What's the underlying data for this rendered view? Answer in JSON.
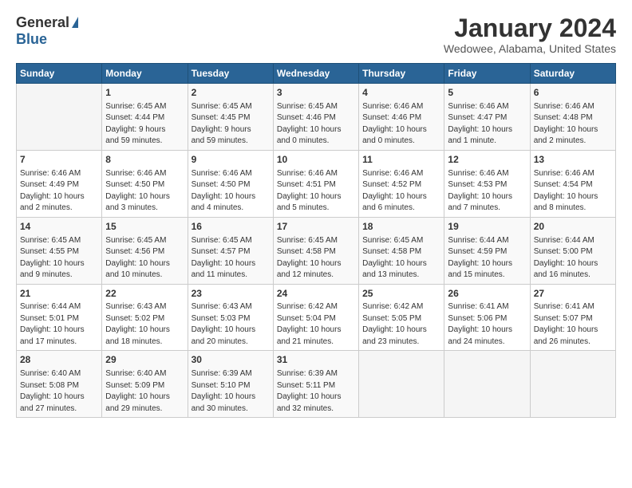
{
  "logo": {
    "general": "General",
    "blue": "Blue"
  },
  "title": "January 2024",
  "subtitle": "Wedowee, Alabama, United States",
  "weekdays": [
    "Sunday",
    "Monday",
    "Tuesday",
    "Wednesday",
    "Thursday",
    "Friday",
    "Saturday"
  ],
  "weeks": [
    [
      {
        "day": "",
        "info": ""
      },
      {
        "day": "1",
        "info": "Sunrise: 6:45 AM\nSunset: 4:44 PM\nDaylight: 9 hours\nand 59 minutes."
      },
      {
        "day": "2",
        "info": "Sunrise: 6:45 AM\nSunset: 4:45 PM\nDaylight: 9 hours\nand 59 minutes."
      },
      {
        "day": "3",
        "info": "Sunrise: 6:45 AM\nSunset: 4:46 PM\nDaylight: 10 hours\nand 0 minutes."
      },
      {
        "day": "4",
        "info": "Sunrise: 6:46 AM\nSunset: 4:46 PM\nDaylight: 10 hours\nand 0 minutes."
      },
      {
        "day": "5",
        "info": "Sunrise: 6:46 AM\nSunset: 4:47 PM\nDaylight: 10 hours\nand 1 minute."
      },
      {
        "day": "6",
        "info": "Sunrise: 6:46 AM\nSunset: 4:48 PM\nDaylight: 10 hours\nand 2 minutes."
      }
    ],
    [
      {
        "day": "7",
        "info": "Sunrise: 6:46 AM\nSunset: 4:49 PM\nDaylight: 10 hours\nand 2 minutes."
      },
      {
        "day": "8",
        "info": "Sunrise: 6:46 AM\nSunset: 4:50 PM\nDaylight: 10 hours\nand 3 minutes."
      },
      {
        "day": "9",
        "info": "Sunrise: 6:46 AM\nSunset: 4:50 PM\nDaylight: 10 hours\nand 4 minutes."
      },
      {
        "day": "10",
        "info": "Sunrise: 6:46 AM\nSunset: 4:51 PM\nDaylight: 10 hours\nand 5 minutes."
      },
      {
        "day": "11",
        "info": "Sunrise: 6:46 AM\nSunset: 4:52 PM\nDaylight: 10 hours\nand 6 minutes."
      },
      {
        "day": "12",
        "info": "Sunrise: 6:46 AM\nSunset: 4:53 PM\nDaylight: 10 hours\nand 7 minutes."
      },
      {
        "day": "13",
        "info": "Sunrise: 6:46 AM\nSunset: 4:54 PM\nDaylight: 10 hours\nand 8 minutes."
      }
    ],
    [
      {
        "day": "14",
        "info": "Sunrise: 6:45 AM\nSunset: 4:55 PM\nDaylight: 10 hours\nand 9 minutes."
      },
      {
        "day": "15",
        "info": "Sunrise: 6:45 AM\nSunset: 4:56 PM\nDaylight: 10 hours\nand 10 minutes."
      },
      {
        "day": "16",
        "info": "Sunrise: 6:45 AM\nSunset: 4:57 PM\nDaylight: 10 hours\nand 11 minutes."
      },
      {
        "day": "17",
        "info": "Sunrise: 6:45 AM\nSunset: 4:58 PM\nDaylight: 10 hours\nand 12 minutes."
      },
      {
        "day": "18",
        "info": "Sunrise: 6:45 AM\nSunset: 4:58 PM\nDaylight: 10 hours\nand 13 minutes."
      },
      {
        "day": "19",
        "info": "Sunrise: 6:44 AM\nSunset: 4:59 PM\nDaylight: 10 hours\nand 15 minutes."
      },
      {
        "day": "20",
        "info": "Sunrise: 6:44 AM\nSunset: 5:00 PM\nDaylight: 10 hours\nand 16 minutes."
      }
    ],
    [
      {
        "day": "21",
        "info": "Sunrise: 6:44 AM\nSunset: 5:01 PM\nDaylight: 10 hours\nand 17 minutes."
      },
      {
        "day": "22",
        "info": "Sunrise: 6:43 AM\nSunset: 5:02 PM\nDaylight: 10 hours\nand 18 minutes."
      },
      {
        "day": "23",
        "info": "Sunrise: 6:43 AM\nSunset: 5:03 PM\nDaylight: 10 hours\nand 20 minutes."
      },
      {
        "day": "24",
        "info": "Sunrise: 6:42 AM\nSunset: 5:04 PM\nDaylight: 10 hours\nand 21 minutes."
      },
      {
        "day": "25",
        "info": "Sunrise: 6:42 AM\nSunset: 5:05 PM\nDaylight: 10 hours\nand 23 minutes."
      },
      {
        "day": "26",
        "info": "Sunrise: 6:41 AM\nSunset: 5:06 PM\nDaylight: 10 hours\nand 24 minutes."
      },
      {
        "day": "27",
        "info": "Sunrise: 6:41 AM\nSunset: 5:07 PM\nDaylight: 10 hours\nand 26 minutes."
      }
    ],
    [
      {
        "day": "28",
        "info": "Sunrise: 6:40 AM\nSunset: 5:08 PM\nDaylight: 10 hours\nand 27 minutes."
      },
      {
        "day": "29",
        "info": "Sunrise: 6:40 AM\nSunset: 5:09 PM\nDaylight: 10 hours\nand 29 minutes."
      },
      {
        "day": "30",
        "info": "Sunrise: 6:39 AM\nSunset: 5:10 PM\nDaylight: 10 hours\nand 30 minutes."
      },
      {
        "day": "31",
        "info": "Sunrise: 6:39 AM\nSunset: 5:11 PM\nDaylight: 10 hours\nand 32 minutes."
      },
      {
        "day": "",
        "info": ""
      },
      {
        "day": "",
        "info": ""
      },
      {
        "day": "",
        "info": ""
      }
    ]
  ],
  "colors": {
    "header_bg": "#2a6496",
    "header_text": "#ffffff",
    "border": "#cccccc",
    "logo_blue": "#2a6496",
    "title_color": "#333333"
  }
}
